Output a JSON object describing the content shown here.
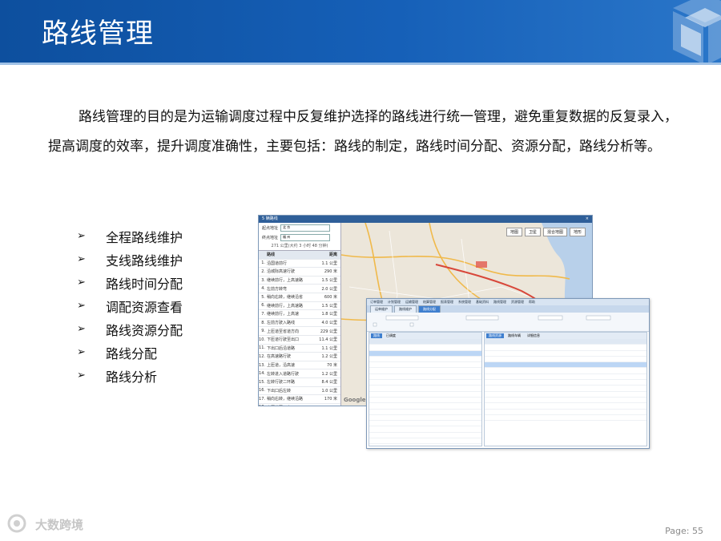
{
  "slide": {
    "title": "路线管理",
    "paragraph": "路线管理的目的是为运输调度过程中反复维护选择的路线进行统一管理，避免重复数据的反复录入，提高调度的效率，提升调度准确性，主要包括：路线的制定，路线时间分配、资源分配，路线分析等。",
    "bullet_marker": "➢",
    "bullets": [
      "全程路线维护",
      "支线路线维护",
      "路线时间分配",
      "调配资源查看",
      "路线资源分配",
      "路线分配",
      "路线分析"
    ],
    "footer_watermark": "大数跨境",
    "page_number": "Page: 55"
  },
  "route_window": {
    "title": "5 辆路线",
    "close_label": "×",
    "origin_label": "起点地址",
    "origin_value": "北 京",
    "dest_label": "终点地址",
    "dest_value": "福 州",
    "summary": "271 公里(大约 3 小时 48 分钟)",
    "col_route": "路线",
    "col_distance": "距离",
    "route_rows": [
      {
        "n": "1.",
        "text": "沿国道前行",
        "dist": "1.1 公里"
      },
      {
        "n": "2.",
        "text": "沿城际高速行驶",
        "dist": "290 米"
      },
      {
        "n": "3.",
        "text": "继续前行，上高速路",
        "dist": "1.5 公里"
      },
      {
        "n": "4.",
        "text": "左前方转弯",
        "dist": "2.0 公里"
      },
      {
        "n": "5.",
        "text": "稍向右转，继续沿省",
        "dist": "600 米"
      },
      {
        "n": "6.",
        "text": "继续前行，上高速路",
        "dist": "1.5 公里"
      },
      {
        "n": "7.",
        "text": "继续前行，上高速",
        "dist": "1.8 公里"
      },
      {
        "n": "8.",
        "text": "左前方驶入路线",
        "dist": "4.0 公里"
      },
      {
        "n": "9.",
        "text": "上匝道至省道方向",
        "dist": "229 公里"
      },
      {
        "n": "10.",
        "text": "下匝道行驶至出口",
        "dist": "11.4 公里"
      },
      {
        "n": "11.",
        "text": "下出口后沿道路",
        "dist": "1.1 公里"
      },
      {
        "n": "12.",
        "text": "在高速路行驶",
        "dist": "1.2 公里"
      },
      {
        "n": "13.",
        "text": "上匝道，沿高速",
        "dist": "70 米"
      },
      {
        "n": "14.",
        "text": "左转进入道路行驶",
        "dist": "1.2 公里"
      },
      {
        "n": "15.",
        "text": "左转行驶二环路",
        "dist": "8.4 公里"
      },
      {
        "n": "16.",
        "text": "下出口后左转",
        "dist": "1.0 公里"
      },
      {
        "n": "17.",
        "text": "稍向右转，继续沿路",
        "dist": "170 米"
      },
      {
        "n": "18.",
        "text": "上匝道至下出口",
        "dist": "1.7 公里"
      }
    ],
    "map_buttons": [
      "地图",
      "卫星",
      "混合地图",
      "地形"
    ],
    "map_brand": "Google"
  },
  "dispatch_window": {
    "menu": [
      "订单管理",
      "计划管理",
      "运输管理",
      "结算管理",
      "报表管理",
      "系统管理",
      "基础资料",
      "路线管理",
      "资源管理",
      "帮助"
    ],
    "tabs": [
      "运单维护",
      "路线维护",
      "路线分配"
    ],
    "active_tab": 2,
    "left_subtabs": [
      "路线",
      "已调度"
    ],
    "right_subtabs": [
      "路线资源",
      "路线车辆",
      "详细信息"
    ],
    "accent": "#3f7fcf"
  }
}
